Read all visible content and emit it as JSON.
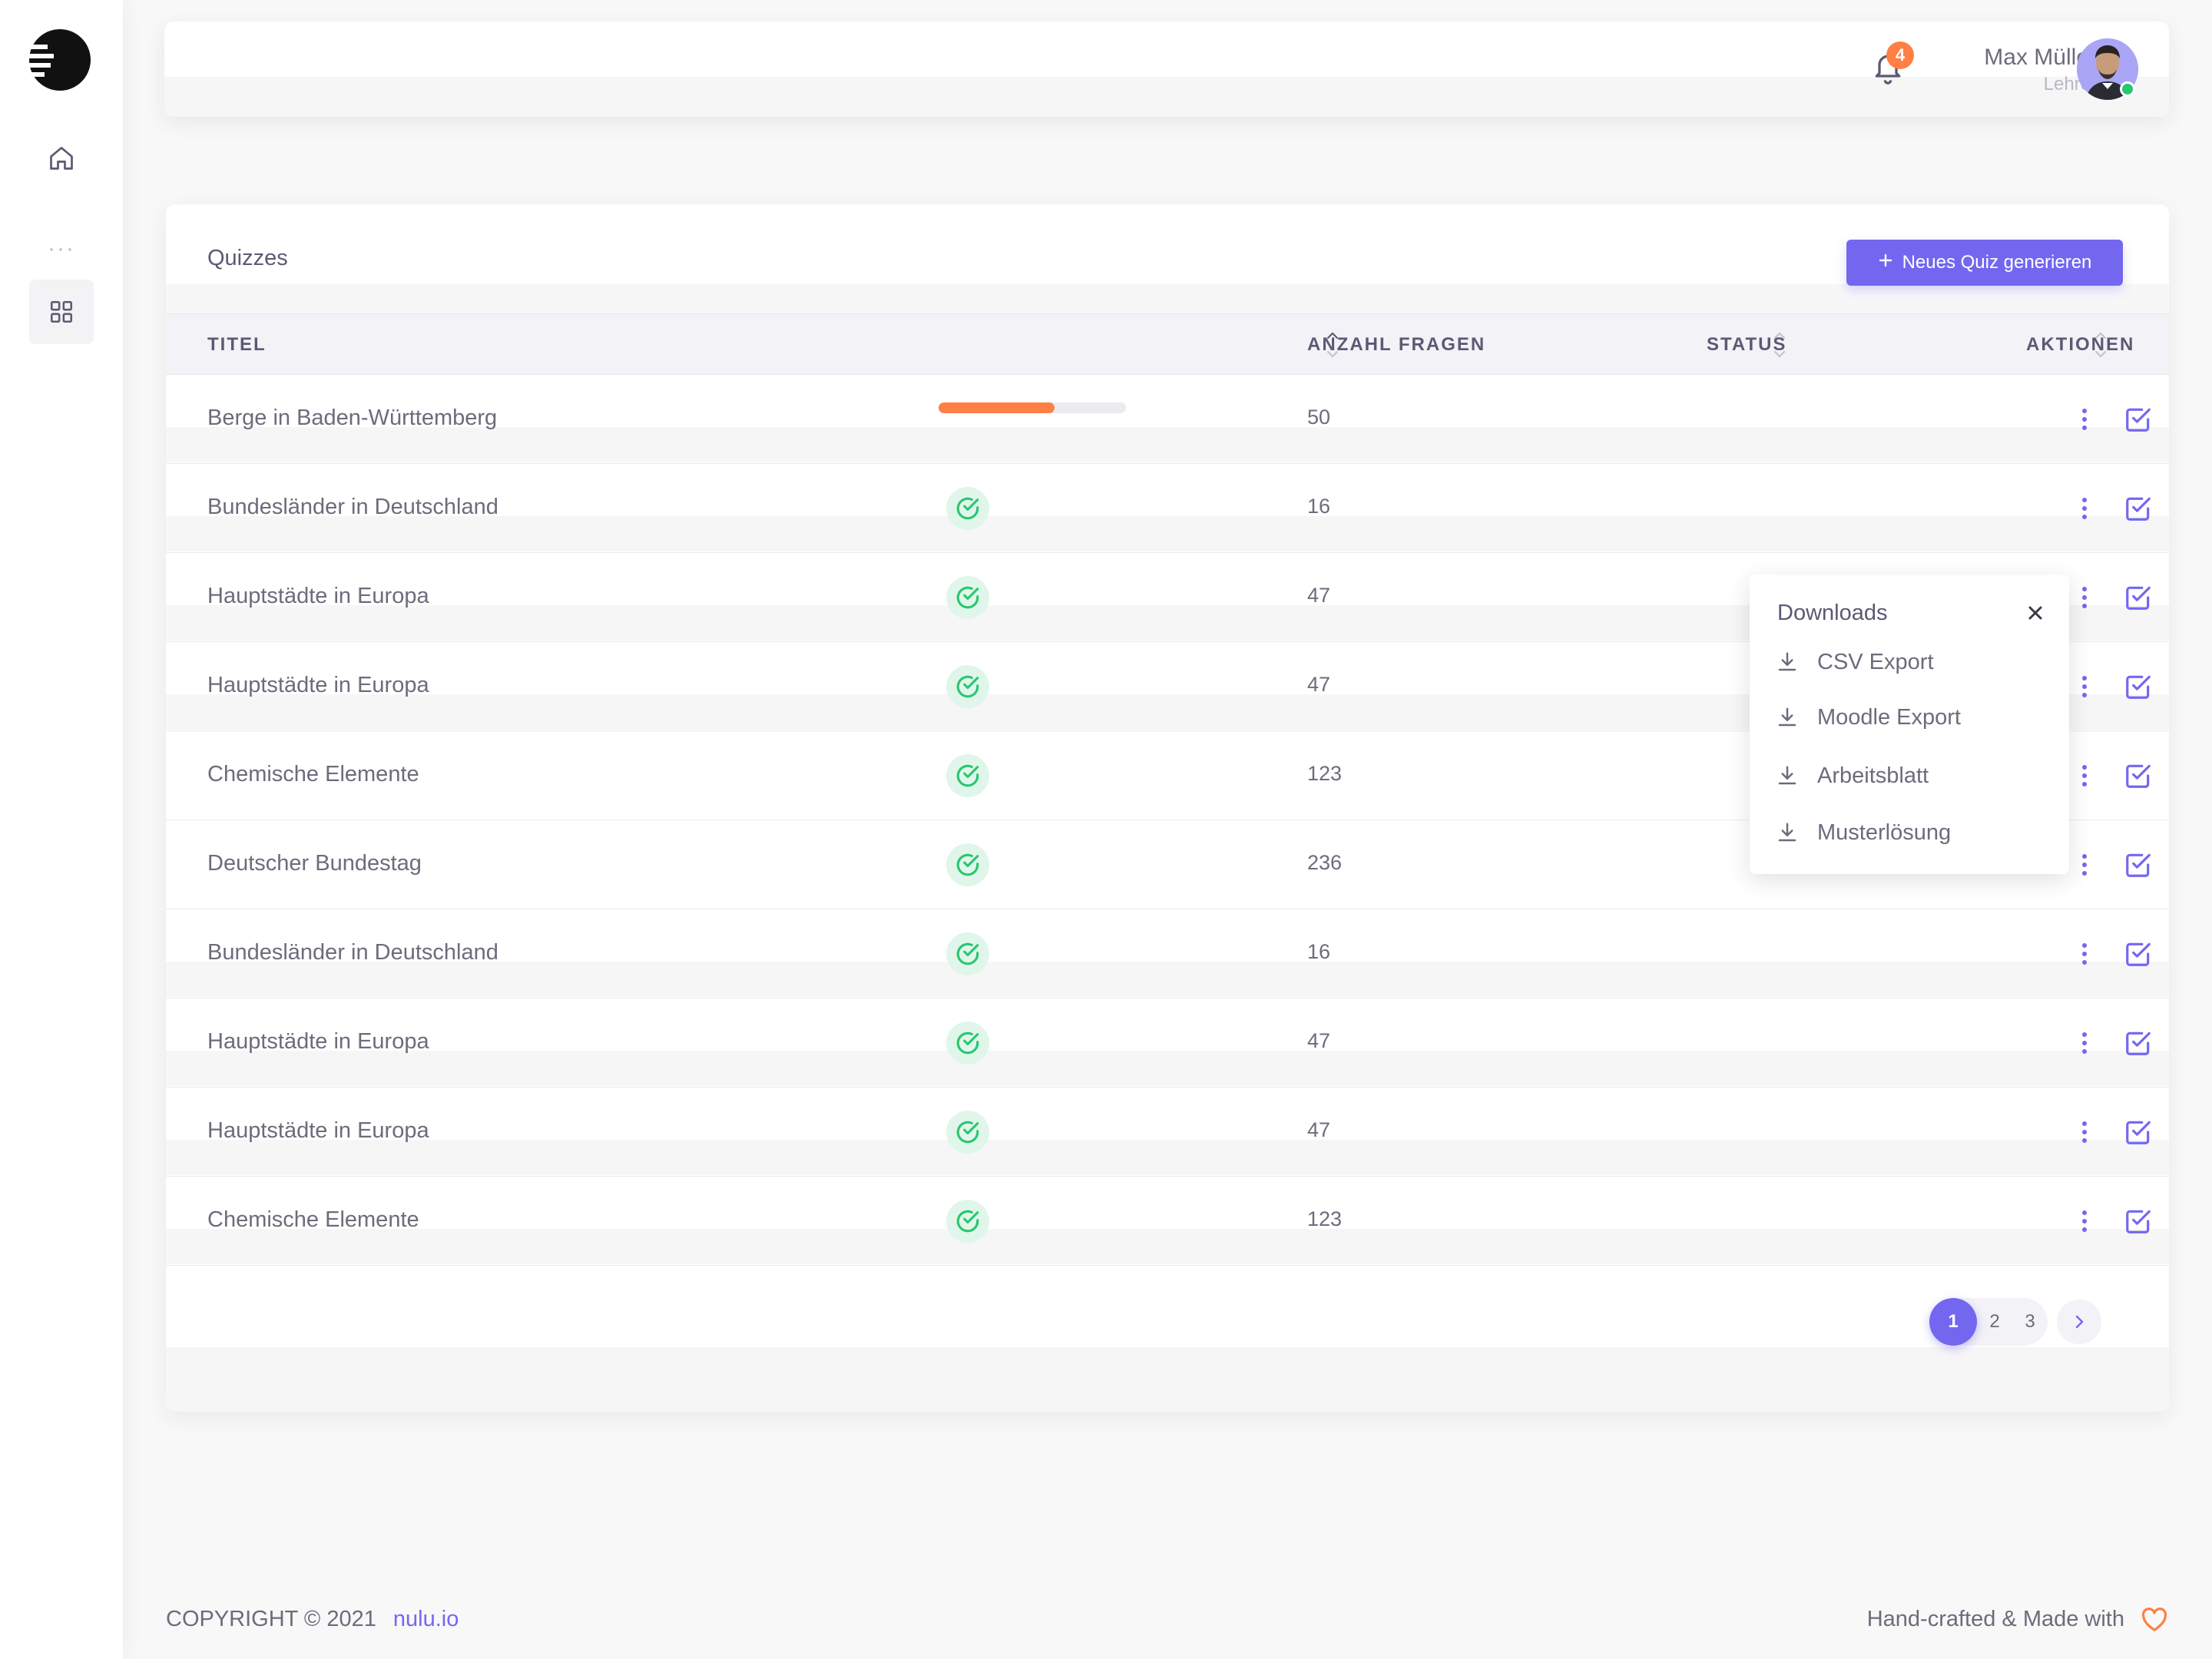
{
  "sidebar": {
    "logo_icon": "brand-logo-icon",
    "items": [
      {
        "icon": "home-icon"
      },
      {
        "icon": "more-horizontal-icon",
        "text": "···"
      },
      {
        "icon": "grid-icon"
      }
    ]
  },
  "navbar": {
    "notifications_count": "4",
    "user_name": "Max Müller",
    "user_role": "Lehrer",
    "status_color": "#28c76f"
  },
  "card": {
    "title": "Quizzes",
    "new_button_label": "Neues Quiz generieren",
    "columns": [
      "TITEL",
      "ANZAHL FRAGEN",
      "STATUS",
      "AKTIONEN"
    ],
    "rows": [
      {
        "title": "Berge in Baden-Württemberg",
        "count": "50",
        "status": "in-progress",
        "progress": 0.62
      },
      {
        "title": "Bundesländer in Deutschland",
        "count": "16",
        "status": "done"
      },
      {
        "title": "Hauptstädte in Europa",
        "count": "47",
        "status": "done"
      },
      {
        "title": "Hauptstädte in Europa",
        "count": "47",
        "status": "done"
      },
      {
        "title": "Chemische Elemente",
        "count": "123",
        "status": "done"
      },
      {
        "title": "Deutscher Bundestag",
        "count": "236",
        "status": "done"
      },
      {
        "title": "Bundesländer in Deutschland",
        "count": "16",
        "status": "done"
      },
      {
        "title": "Hauptstädte in Europa",
        "count": "47",
        "status": "done"
      },
      {
        "title": "Hauptstädte in Europa",
        "count": "47",
        "status": "done"
      },
      {
        "title": "Chemische Elemente",
        "count": "123",
        "status": "done"
      }
    ],
    "pagination": {
      "pages": [
        "1",
        "2",
        "3"
      ],
      "current": "1"
    }
  },
  "dropdown": {
    "title": "Downloads",
    "items": [
      "CSV Export",
      "Moodle Export",
      "Arbeitsblatt",
      "Musterlösung"
    ]
  },
  "footer": {
    "copyright": "COPYRIGHT © 2021",
    "brand": "nulu.io",
    "right_text": "Hand-crafted & Made with"
  },
  "colors": {
    "primary": "#7367f0",
    "success": "#28c76f",
    "warning": "#ff7f45"
  }
}
